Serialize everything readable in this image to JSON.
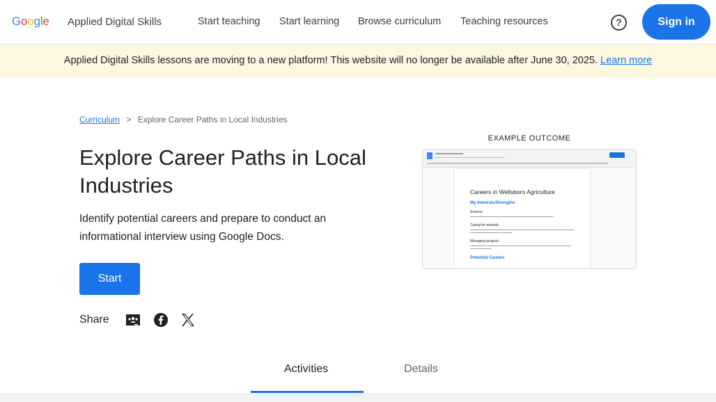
{
  "header": {
    "logo": "Google",
    "product": "Applied Digital Skills",
    "nav": [
      "Start teaching",
      "Start learning",
      "Browse curriculum",
      "Teaching resources"
    ],
    "help_icon": "help-circle-icon",
    "signin": "Sign in"
  },
  "banner": {
    "text": "Applied Digital Skills lessons are moving to a new platform! This website will no longer be available after June 30, 2025.",
    "link": "Learn more"
  },
  "breadcrumb": {
    "root": "Curriculum",
    "separator": ">",
    "current": "Explore Career Paths in Local Industries"
  },
  "lesson": {
    "title": "Explore Career Paths in Local Industries",
    "description": "Identify potential careers and prepare to conduct an informational interview using Google Docs.",
    "start": "Start",
    "share_label": "Share",
    "share_icons": [
      "google-classroom-icon",
      "facebook-icon",
      "x-icon"
    ]
  },
  "outcome": {
    "label": "EXAMPLE OUTCOME",
    "doc_title": "Careers in Wellsboro Agriculture",
    "section1": "My Interests/Strengths",
    "item1": "Science",
    "item2": "Caring for animals",
    "item3": "Managing projects",
    "section2": "Potential Careers"
  },
  "tabs": {
    "activities": "Activities",
    "details": "Details"
  }
}
